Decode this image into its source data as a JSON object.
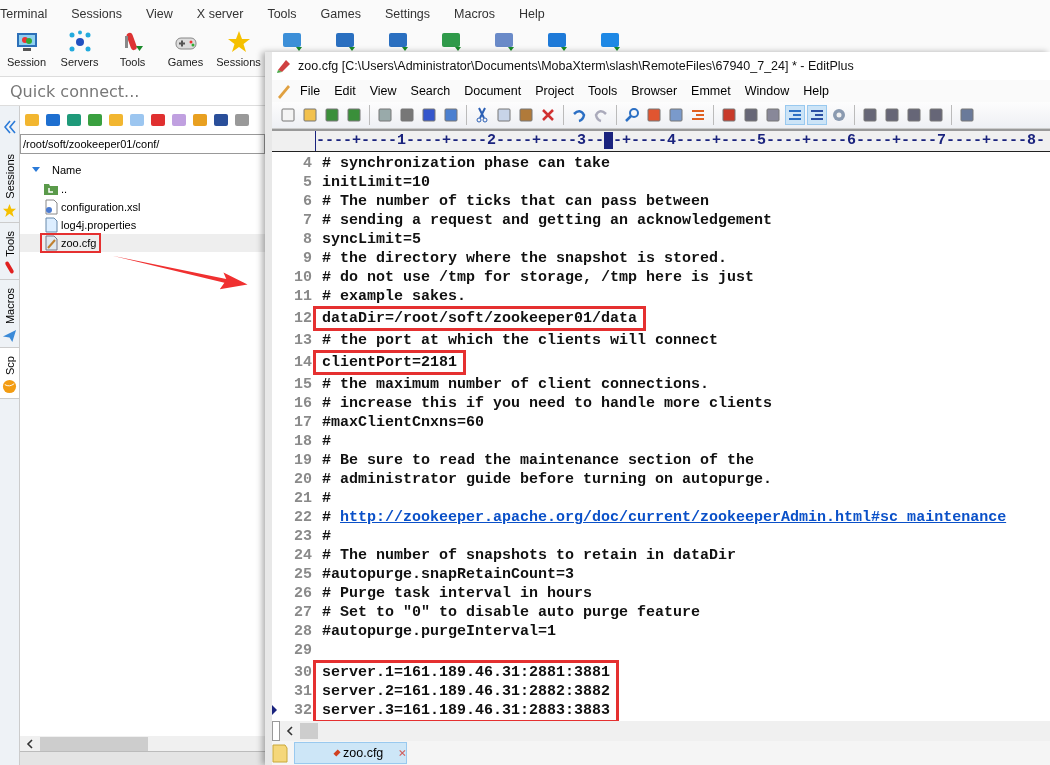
{
  "moba": {
    "menu": [
      "Terminal",
      "Sessions",
      "View",
      "X server",
      "Tools",
      "Games",
      "Settings",
      "Macros",
      "Help"
    ],
    "toolbar": [
      {
        "label": "Session",
        "kind": "monitor"
      },
      {
        "label": "Servers",
        "kind": "network"
      },
      {
        "label": "Tools",
        "kind": "tools"
      },
      {
        "label": "Games",
        "kind": "gamepad"
      },
      {
        "label": "Sessions",
        "kind": "star"
      }
    ],
    "quick_connect": {
      "placeholder": "Quick connect..."
    },
    "side_tabs": [
      {
        "label": "Sessions",
        "selected": false,
        "kind": "star"
      },
      {
        "label": "Tools",
        "selected": false,
        "kind": "tools"
      },
      {
        "label": "Macros",
        "selected": false,
        "kind": "plane"
      },
      {
        "label": "Scp",
        "selected": true,
        "kind": "globe"
      }
    ],
    "path": "/root/soft/zookeeper01/conf/",
    "column": "Name",
    "files": [
      {
        "name": "..",
        "kind": "parent",
        "selected": false,
        "boxed": false
      },
      {
        "name": "configuration.xsl",
        "kind": "xsl",
        "selected": false,
        "boxed": false
      },
      {
        "name": "log4j.properties",
        "kind": "file",
        "selected": false,
        "boxed": false
      },
      {
        "name": "zoo.cfg",
        "kind": "cfg",
        "selected": true,
        "boxed": true
      }
    ]
  },
  "editor": {
    "title": "zoo.cfg [C:\\Users\\Administrator\\Documents\\MobaXterm\\slash\\RemoteFiles\\67940_7_24] * - EditPlus",
    "menu": [
      "File",
      "Edit",
      "View",
      "Search",
      "Document",
      "Project",
      "Tools",
      "Browser",
      "Emmet",
      "Window",
      "Help"
    ],
    "toolbar": [
      {
        "kind": "new",
        "on": false
      },
      {
        "kind": "open",
        "on": false
      },
      {
        "kind": "save",
        "on": false
      },
      {
        "kind": "saveall",
        "on": false
      },
      {
        "kind": "sep"
      },
      {
        "kind": "preview",
        "on": false
      },
      {
        "kind": "print",
        "on": false
      },
      {
        "kind": "spell",
        "on": false
      },
      {
        "kind": "browser",
        "on": false
      },
      {
        "kind": "sep"
      },
      {
        "kind": "cut",
        "on": false
      },
      {
        "kind": "copy",
        "on": false
      },
      {
        "kind": "paste",
        "on": false
      },
      {
        "kind": "delete",
        "on": false
      },
      {
        "kind": "sep"
      },
      {
        "kind": "undo",
        "on": false
      },
      {
        "kind": "redo",
        "on": false
      },
      {
        "kind": "sep"
      },
      {
        "kind": "find",
        "on": false
      },
      {
        "kind": "replace",
        "on": false
      },
      {
        "kind": "findfiles",
        "on": false
      },
      {
        "kind": "linenum",
        "on": false
      },
      {
        "kind": "sep"
      },
      {
        "kind": "font",
        "on": false
      },
      {
        "kind": "hx",
        "on": false
      },
      {
        "kind": "w",
        "on": false
      },
      {
        "kind": "wrap",
        "on": true
      },
      {
        "kind": "ruler",
        "on": true
      },
      {
        "kind": "gear",
        "on": false
      },
      {
        "kind": "sep"
      },
      {
        "kind": "panel",
        "on": false
      },
      {
        "kind": "panel",
        "on": false
      },
      {
        "kind": "panel",
        "on": false
      },
      {
        "kind": "panel",
        "on": false
      },
      {
        "kind": "sep"
      },
      {
        "kind": "help",
        "on": false
      }
    ],
    "ruler": {
      "before": "----+----1----+----2----+----3--",
      "after": "-+----4----+----5----+----6----+----7----+----8-"
    },
    "lines": [
      {
        "n": "4",
        "text": "# synchronization phase can take",
        "boxed": false,
        "current": false
      },
      {
        "n": "5",
        "text": "initLimit=10",
        "boxed": false,
        "current": false
      },
      {
        "n": "6",
        "text": "# The number of ticks that can pass between",
        "boxed": false,
        "current": false
      },
      {
        "n": "7",
        "text": "# sending a request and getting an acknowledgement",
        "boxed": false,
        "current": false
      },
      {
        "n": "8",
        "text": "syncLimit=5",
        "boxed": false,
        "current": false
      },
      {
        "n": "9",
        "text": "# the directory where the snapshot is stored.",
        "boxed": false,
        "current": false
      },
      {
        "n": "10",
        "text": "# do not use /tmp for storage, /tmp here is just",
        "boxed": false,
        "current": false
      },
      {
        "n": "11",
        "text": "# example sakes.",
        "boxed": false,
        "current": false
      },
      {
        "n": "12",
        "text": "dataDir=/root/soft/zookeeper01/data",
        "boxed": true,
        "current": false
      },
      {
        "n": "13",
        "text": "# the port at which the clients will connect",
        "boxed": false,
        "current": false
      },
      {
        "n": "14",
        "text": "clientPort=2181",
        "boxed": true,
        "current": false
      },
      {
        "n": "15",
        "text": "# the maximum number of client connections.",
        "boxed": false,
        "current": false
      },
      {
        "n": "16",
        "text": "# increase this if you need to handle more clients",
        "boxed": false,
        "current": false
      },
      {
        "n": "17",
        "text": "#maxClientCnxns=60",
        "boxed": false,
        "current": false
      },
      {
        "n": "18",
        "text": "#",
        "boxed": false,
        "current": false
      },
      {
        "n": "19",
        "text": "# Be sure to read the maintenance section of the",
        "boxed": false,
        "current": false
      },
      {
        "n": "20",
        "text": "# administrator guide before turning on autopurge.",
        "boxed": false,
        "current": false
      },
      {
        "n": "21",
        "text": "#",
        "boxed": false,
        "current": false
      },
      {
        "n": "22",
        "text": "#",
        "link": "http://zookeeper.apache.org/doc/current/zookeeperAdmin.html#sc_maintenance",
        "boxed": false,
        "current": false
      },
      {
        "n": "23",
        "text": "#",
        "boxed": false,
        "current": false
      },
      {
        "n": "24",
        "text": "# The number of snapshots to retain in dataDir",
        "boxed": false,
        "current": false
      },
      {
        "n": "25",
        "text": "#autopurge.snapRetainCount=3",
        "boxed": false,
        "current": false
      },
      {
        "n": "26",
        "text": "# Purge task interval in hours",
        "boxed": false,
        "current": false
      },
      {
        "n": "27",
        "text": "# Set to \"0\" to disable auto purge feature",
        "boxed": false,
        "current": false
      },
      {
        "n": "28",
        "text": "#autopurge.purgeInterval=1",
        "boxed": false,
        "current": false
      },
      {
        "n": "29",
        "boxed": false,
        "current": false
      },
      {
        "n": "30",
        "text": "server.1=161.189.46.31:2881:3881",
        "boxed": true,
        "current": false
      },
      {
        "n": "31",
        "text": "server.2=161.189.46.31:2882:3882",
        "boxed": true,
        "current": false
      },
      {
        "n": "32",
        "text": "server.3=161.189.46.31:2883:3883",
        "boxed": true,
        "current": true
      }
    ],
    "tabs": [
      {
        "label": "zoo.cfg",
        "selected": true
      }
    ]
  }
}
